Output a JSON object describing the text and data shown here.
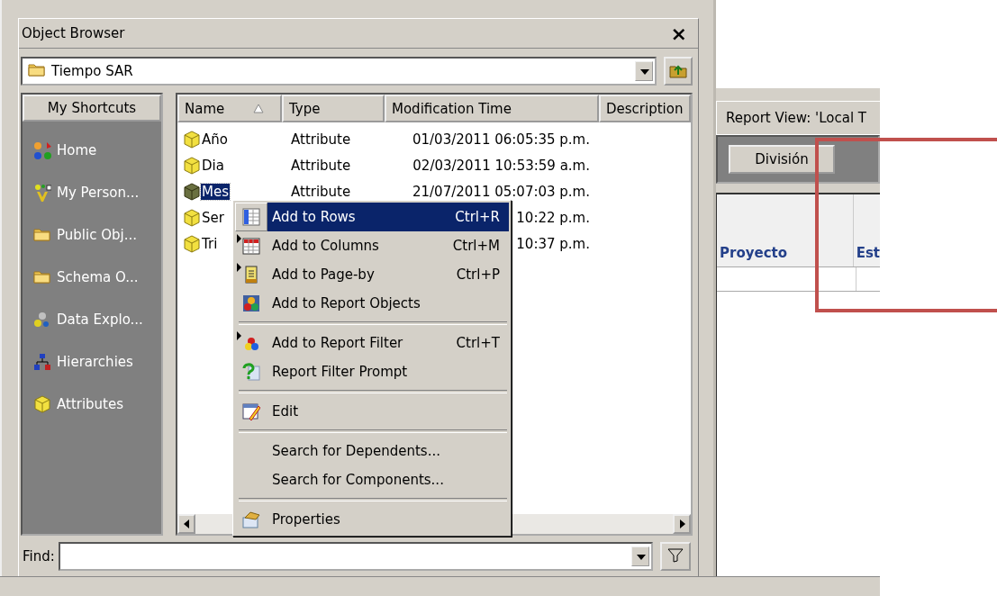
{
  "panel": {
    "title": "Object Browser",
    "close": "×"
  },
  "location": {
    "value": "Tiempo SAR"
  },
  "shortcuts": {
    "header": "My Shortcuts",
    "items": [
      {
        "label": "Home"
      },
      {
        "label": "My Person..."
      },
      {
        "label": "Public Obj..."
      },
      {
        "label": "Schema O..."
      },
      {
        "label": "Data Explo..."
      },
      {
        "label": "Hierarchies"
      },
      {
        "label": "Attributes"
      }
    ]
  },
  "table": {
    "columns": [
      {
        "label": "Name",
        "sorted": true
      },
      {
        "label": "Type",
        "sorted": false
      },
      {
        "label": "Modification Time",
        "sorted": false
      },
      {
        "label": "Description",
        "sorted": false
      }
    ],
    "rows": [
      {
        "name": "Año",
        "type": "Attribute",
        "time": "01/03/2011 06:05:35 p.m.",
        "selected": false
      },
      {
        "name": "Dia",
        "type": "Attribute",
        "time": "02/03/2011 10:53:59 a.m.",
        "selected": false
      },
      {
        "name": "Mes",
        "type": "Attribute",
        "time": "21/07/2011 05:07:03 p.m.",
        "selected": true
      },
      {
        "name": "Ser",
        "time": "10:22 p.m.",
        "selected": false
      },
      {
        "name": "Tri",
        "time": "10:37 p.m.",
        "selected": false
      }
    ]
  },
  "context_menu": [
    {
      "kind": "item",
      "label": "Add to Rows",
      "shortcut": "Ctrl+R",
      "selected": true,
      "submenu": false
    },
    {
      "kind": "item",
      "label": "Add to Columns",
      "shortcut": "Ctrl+M",
      "selected": false,
      "submenu": true
    },
    {
      "kind": "item",
      "label": "Add to Page-by",
      "shortcut": "Ctrl+P",
      "selected": false,
      "submenu": true
    },
    {
      "kind": "item",
      "label": "Add to Report Objects",
      "selected": false,
      "submenu": false
    },
    {
      "kind": "separator"
    },
    {
      "kind": "item",
      "label": "Add to Report Filter",
      "shortcut": "Ctrl+T",
      "selected": false,
      "submenu": true
    },
    {
      "kind": "item",
      "label": "Report Filter Prompt",
      "selected": false,
      "submenu": false
    },
    {
      "kind": "separator"
    },
    {
      "kind": "item",
      "label": "Edit",
      "selected": false,
      "submenu": false
    },
    {
      "kind": "separator"
    },
    {
      "kind": "item",
      "label": "Search for Dependents...",
      "selected": false,
      "submenu": false
    },
    {
      "kind": "item",
      "label": "Search for Components...",
      "selected": false,
      "submenu": false
    },
    {
      "kind": "separator"
    },
    {
      "kind": "item",
      "label": "Properties",
      "selected": false,
      "submenu": false
    }
  ],
  "find": {
    "label": "Find:"
  },
  "report_view": {
    "title": "Report View: 'Local T",
    "page_by_button": "División",
    "columns": [
      "Proyecto",
      "Est"
    ]
  }
}
